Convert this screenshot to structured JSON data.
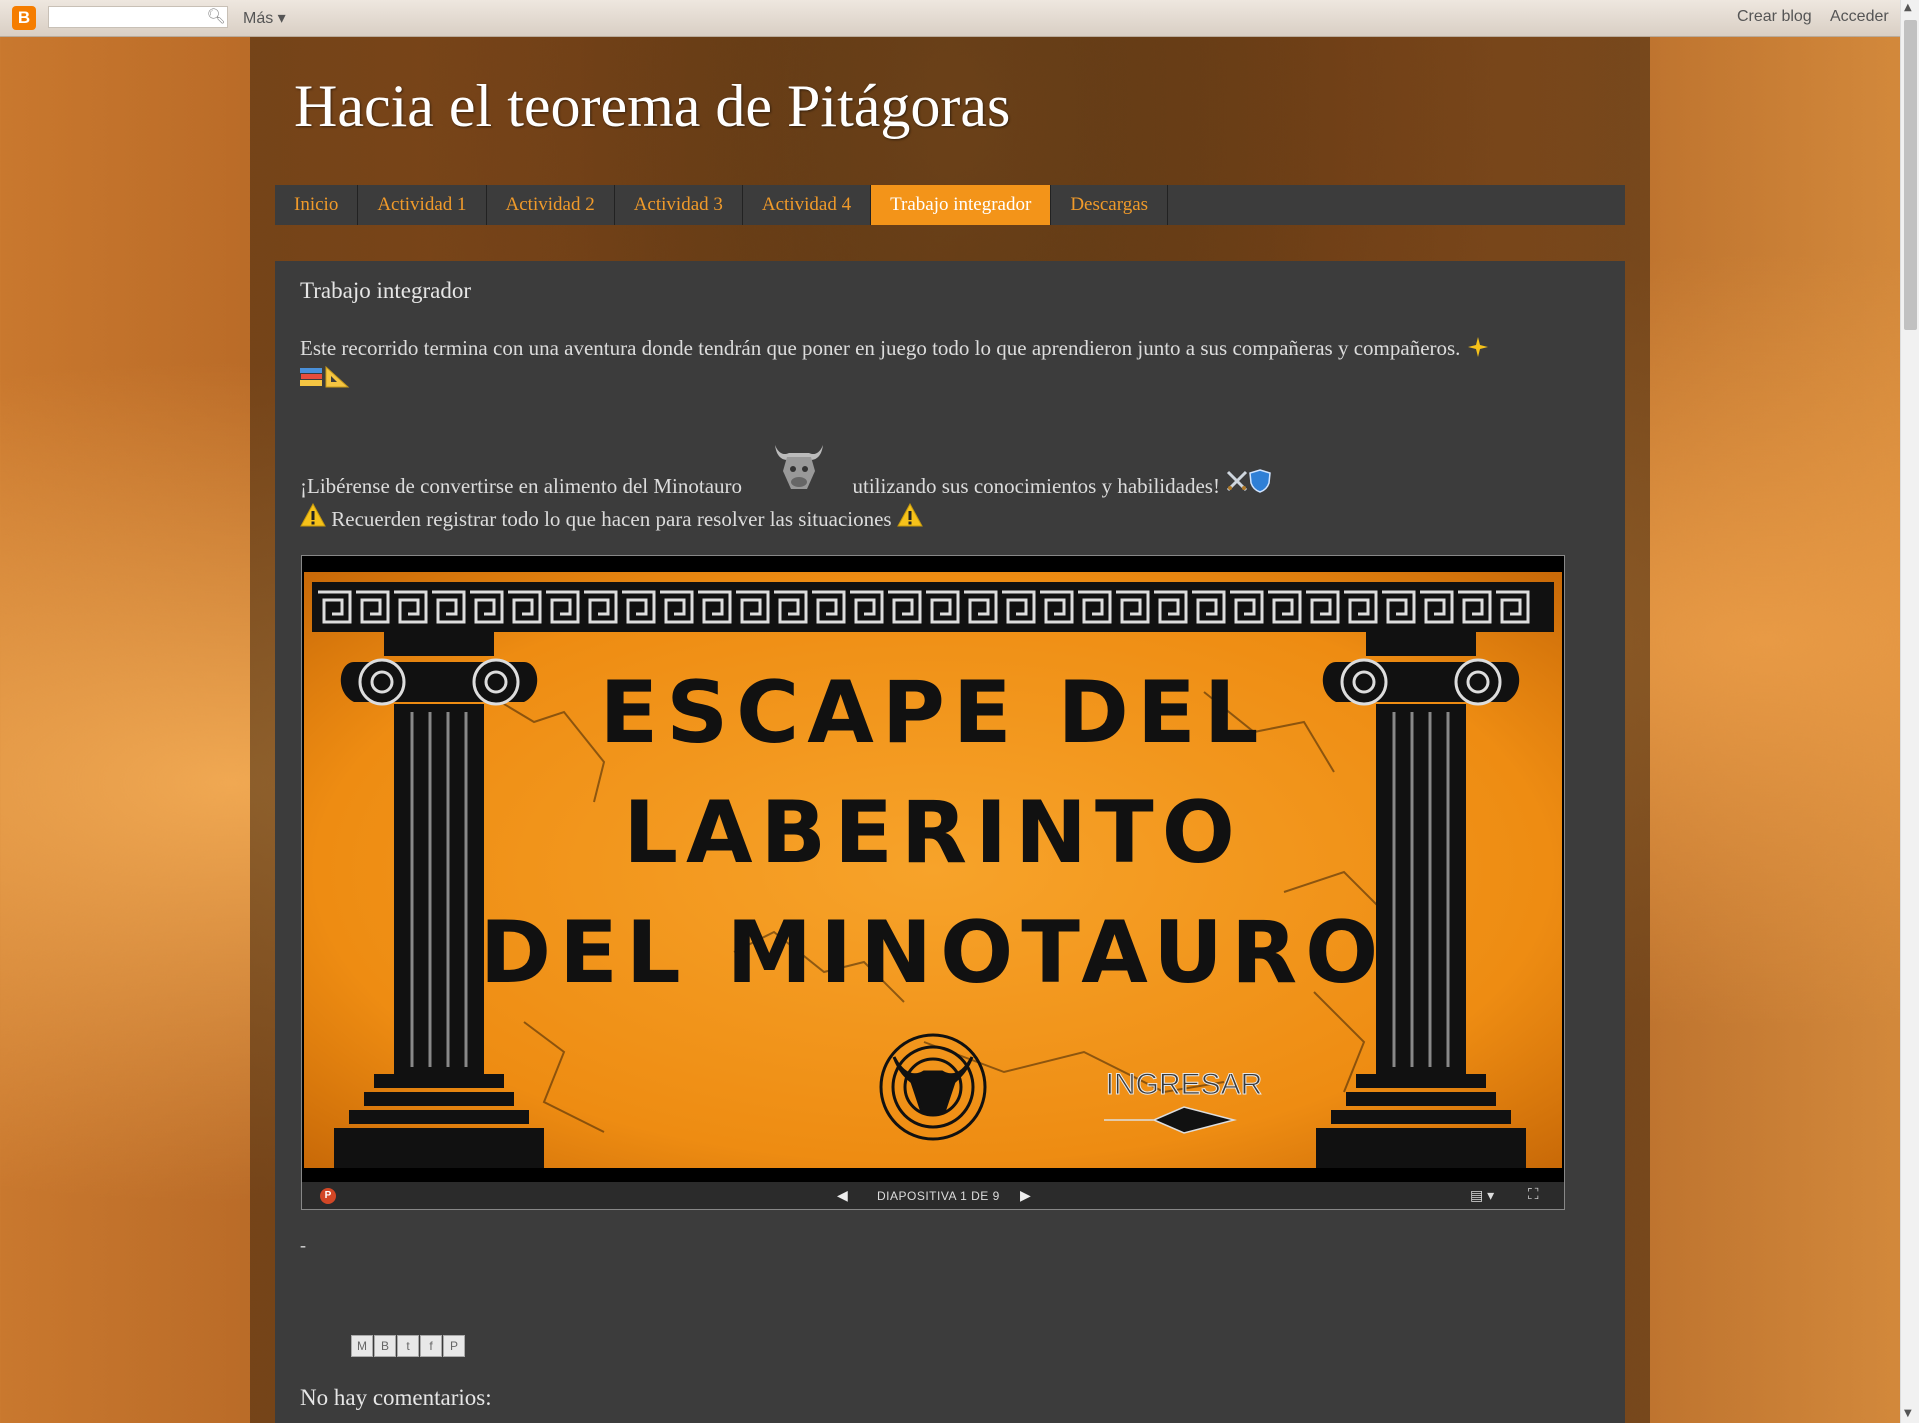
{
  "navbar": {
    "logo_letter": "B",
    "search_placeholder": "",
    "more_label": "Más ▾",
    "create_blog": "Crear blog",
    "sign_in": "Acceder"
  },
  "blog": {
    "title": "Hacia el teorema de Pitágoras"
  },
  "tabs": [
    {
      "label": "Inicio",
      "active": false
    },
    {
      "label": "Actividad 1",
      "active": false
    },
    {
      "label": "Actividad 2",
      "active": false
    },
    {
      "label": "Actividad 3",
      "active": false
    },
    {
      "label": "Actividad 4",
      "active": false
    },
    {
      "label": "Trabajo integrador",
      "active": true
    },
    {
      "label": "Descargas",
      "active": false
    }
  ],
  "post": {
    "title": "Trabajo integrador",
    "paragraph1": "Este recorrido termina con una aventura donde tendrán que poner en juego todo lo que aprendieron junto a sus compañeras y compañeros.",
    "paragraph2_before": "¡Libérense de convertirse en alimento del Minotauro",
    "paragraph2_after": "utilizando sus conocimientos y habilidades!",
    "paragraph3": "Recuerden registrar todo lo que hacen para resolver las situaciones",
    "dash": "-",
    "comments_heading": "No hay comentarios:"
  },
  "slideshow": {
    "line1": "ESCAPE DEL",
    "line2": "LABERINTO",
    "line3": "DEL MINOTAURO",
    "ingresar": "INGRESAR",
    "counter": "DIAPOSITIVA 1 DE 9",
    "accent_color": "#f39419"
  },
  "share_buttons": [
    "M",
    "B",
    "t",
    "f",
    "P"
  ],
  "colors": {
    "tab_active_bg": "#f39419",
    "tab_text": "#f09a2a",
    "content_bg": "#3c3c3c"
  }
}
